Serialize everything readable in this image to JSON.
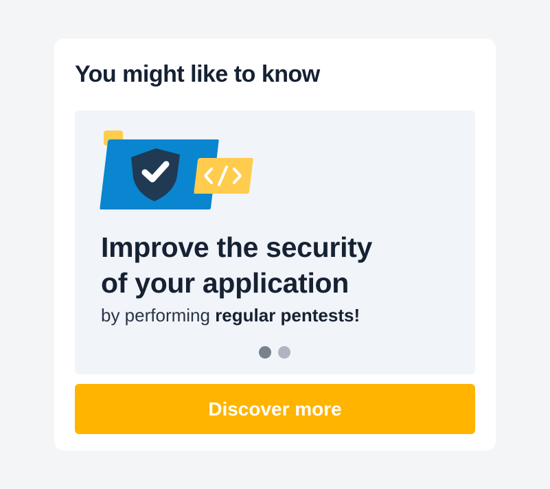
{
  "card": {
    "title": "You might like to know"
  },
  "promo": {
    "headline_line1": "Improve the security",
    "headline_line2": "of your application",
    "subline_prefix": "by performing ",
    "subline_emphasis": "regular pentests!",
    "carousel": {
      "total_slides": 2,
      "active_slide": 1
    },
    "illustration": {
      "icons": [
        "shield-check-icon",
        "code-brackets-icon"
      ],
      "colors": {
        "panel": "#0a85d0",
        "shield": "#1f3a52",
        "code_tag": "#ffcc4d",
        "accent_square": "#ffcc4d"
      }
    }
  },
  "cta": {
    "label": "Discover more",
    "color": "#ffb400"
  }
}
